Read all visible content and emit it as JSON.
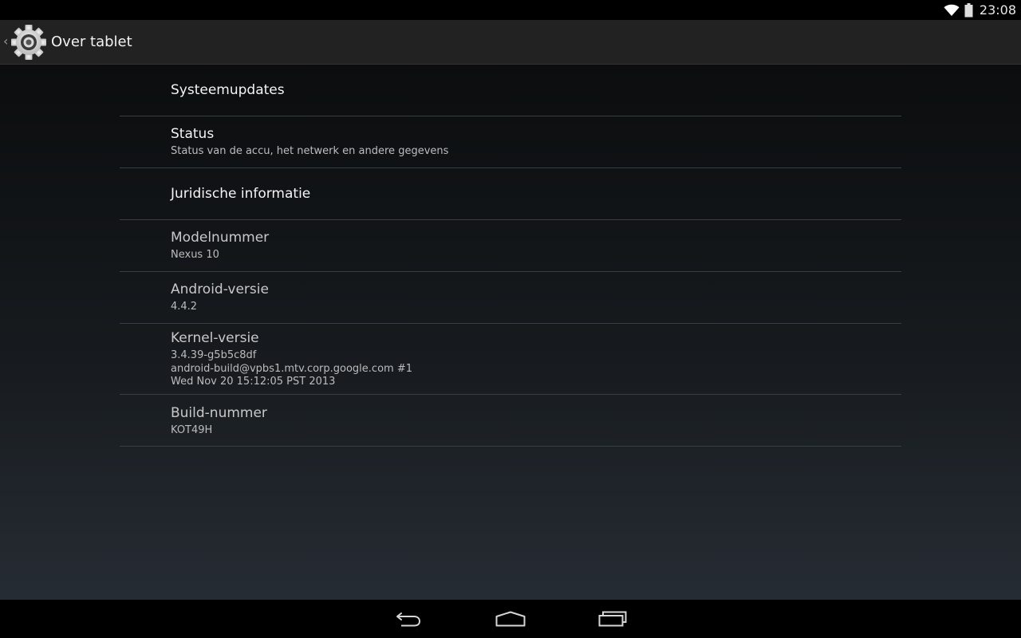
{
  "status_bar": {
    "time": "23:08",
    "icons": [
      "wifi-icon",
      "battery-icon"
    ]
  },
  "action_bar": {
    "title": "Over tablet",
    "icon": "settings-gear-icon"
  },
  "preferences": [
    {
      "title": "Systeemupdates"
    },
    {
      "title": "Status",
      "summary": "Status van de accu, het netwerk en andere gegevens"
    },
    {
      "title": "Juridische informatie"
    },
    {
      "title": "Modelnummer",
      "summary": "Nexus 10"
    },
    {
      "title": "Android-versie",
      "summary": "4.4.2"
    },
    {
      "title": "Kernel-versie",
      "summary_lines": [
        "3.4.39-g5b5c8df",
        "android-build@vpbs1.mtv.corp.google.com #1",
        "Wed Nov 20 15:12:05 PST 2013"
      ]
    },
    {
      "title": "Build-nummer",
      "summary": "KOT49H"
    }
  ],
  "nav_bar": {
    "buttons": [
      "back-icon",
      "home-icon",
      "recents-icon"
    ]
  }
}
